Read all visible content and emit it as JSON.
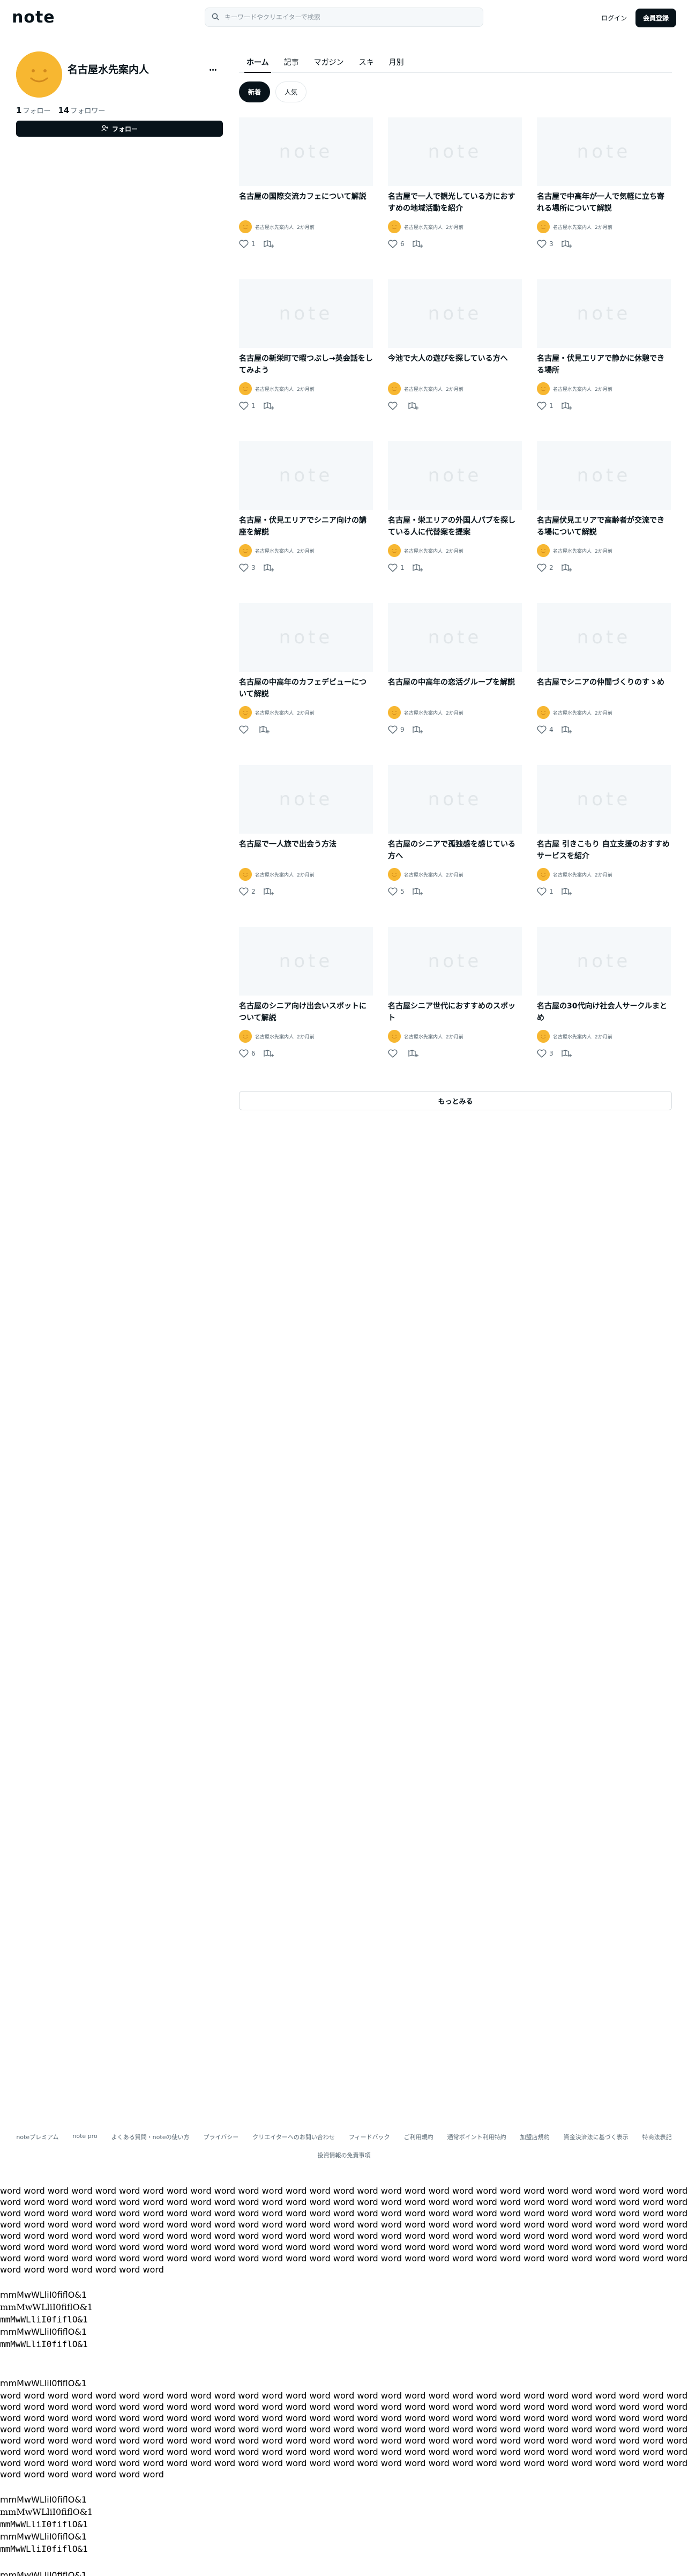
{
  "header": {
    "logo": "note",
    "search_placeholder": "キーワードやクリエイターで検索",
    "login_label": "ログイン",
    "signup_label": "会員登録"
  },
  "profile": {
    "name": "名古屋水先案内人",
    "following_count": "1",
    "following_label": "フォロー",
    "followers_count": "14",
    "followers_label": "フォロワー",
    "follow_button": "フォロー",
    "more_label": "•••"
  },
  "tabs": [
    "ホーム",
    "記事",
    "マガジン",
    "スキ",
    "月別"
  ],
  "pills": [
    "新着",
    "人気"
  ],
  "articles": [
    {
      "title": "名古屋の国際交流カフェについて解説",
      "author": "名古屋水先案内人",
      "time": "2か月前",
      "likes": "1"
    },
    {
      "title": "名古屋で一人で観光している方におすすめの地域活動を紹介",
      "author": "名古屋水先案内人",
      "time": "2か月前",
      "likes": "6"
    },
    {
      "title": "名古屋で中高年が一人で気軽に立ち寄れる場所について解説",
      "author": "名古屋水先案内人",
      "time": "2か月前",
      "likes": "3"
    },
    {
      "title": "名古屋の新栄町で暇つぶし→英会話をしてみよう",
      "author": "名古屋水先案内人",
      "time": "2か月前",
      "likes": "1"
    },
    {
      "title": "今池で大人の遊びを探している方へ",
      "author": "名古屋水先案内人",
      "time": "2か月前",
      "likes": ""
    },
    {
      "title": "名古屋・伏見エリアで静かに休憩できる場所",
      "author": "名古屋水先案内人",
      "time": "2か月前",
      "likes": "1"
    },
    {
      "title": "名古屋・伏見エリアでシニア向けの講座を解説",
      "author": "名古屋水先案内人",
      "time": "2か月前",
      "likes": "3"
    },
    {
      "title": "名古屋・栄エリアの外国人パブを探している人に代替案を提案",
      "author": "名古屋水先案内人",
      "time": "2か月前",
      "likes": "1"
    },
    {
      "title": "名古屋伏見エリアで高齢者が交流できる場について解説",
      "author": "名古屋水先案内人",
      "time": "2か月前",
      "likes": "2"
    },
    {
      "title": "名古屋の中高年のカフェデビューについて解説",
      "author": "名古屋水先案内人",
      "time": "2か月前",
      "likes": ""
    },
    {
      "title": "名古屋の中高年の恋活グループを解説",
      "author": "名古屋水先案内人",
      "time": "2か月前",
      "likes": "9"
    },
    {
      "title": "名古屋でシニアの仲間づくりのすゝめ",
      "author": "名古屋水先案内人",
      "time": "2か月前",
      "likes": "4"
    },
    {
      "title": "名古屋で一人旅で出会う方法",
      "author": "名古屋水先案内人",
      "time": "2か月前",
      "likes": "2"
    },
    {
      "title": "名古屋のシニアで孤独感を感じている方へ",
      "author": "名古屋水先案内人",
      "time": "2か月前",
      "likes": "5"
    },
    {
      "title": "名古屋 引きこもり 自立支援のおすすめサービスを紹介",
      "author": "名古屋水先案内人",
      "time": "2か月前",
      "likes": "1"
    },
    {
      "title": "名古屋のシニア向け出会いスポットについて解説",
      "author": "名古屋水先案内人",
      "time": "2か月前",
      "likes": "6"
    },
    {
      "title": "名古屋シニア世代におすすめのスポット",
      "author": "名古屋水先案内人",
      "time": "2か月前",
      "likes": ""
    },
    {
      "title": "名古屋の30代向け社会人サークルまとめ",
      "author": "名古屋水先案内人",
      "time": "2か月前",
      "likes": "3"
    }
  ],
  "thumb_logo": "note",
  "see_more": "もっとみる",
  "footer": {
    "links": [
      "noteプレミアム",
      "note pro",
      "よくある質問・noteの使い方",
      "プライバシー",
      "クリエイターへのお問い合わせ",
      "フィードバック",
      "ご利用規約",
      "通常ポイント利用特約",
      "加盟店規約",
      "資金決済法に基づく表示",
      "特商法表記"
    ],
    "second": "投資情報の免責事項"
  },
  "fonttest": {
    "word": "word",
    "glyphs": "mmMwWLliI0fiflO&1"
  }
}
